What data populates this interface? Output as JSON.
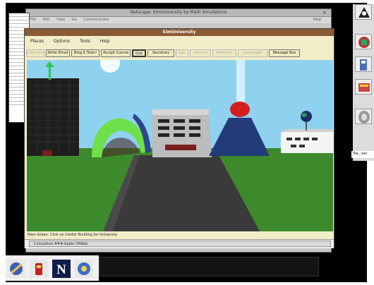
{
  "background_window": {
    "title": "Netscape: SimUniversity by Math Simulations",
    "menu": [
      "File",
      "Edit",
      "View",
      "Go",
      "Communicator"
    ],
    "help": "Help",
    "close": "×"
  },
  "main_window": {
    "title": "SimUniversity",
    "menu": [
      "Places",
      "Options",
      "Tools",
      "Help"
    ],
    "toolbar": [
      {
        "label": "Class Enroll",
        "enabled": false
      },
      {
        "label": "Write Email",
        "enabled": true
      },
      {
        "label": "Blog It Town!",
        "enabled": true
      },
      {
        "label": "Accept Course",
        "enabled": true
      },
      {
        "label": "Quit",
        "enabled": true,
        "pressed": true
      },
      {
        "label": "Secretary",
        "enabled": true
      },
      {
        "label": "Lab",
        "enabled": false
      },
      {
        "label": "General",
        "enabled": false
      },
      {
        "label": "Research",
        "enabled": false
      },
      {
        "label": "Languages",
        "enabled": false
      },
      {
        "label": "Message Box",
        "enabled": true
      }
    ],
    "status": "Main Green: Click on Center Building for University",
    "sub_status": "Completed ###.Apple VRWeb"
  },
  "right_caption": "Tra...nel",
  "colors": {
    "sky": "#8fd2f0",
    "grass": "#3d8a2c",
    "road": "#3a3a3a",
    "title_bar": "#8a5a34",
    "window_bg": "#f1edc8"
  },
  "icons": [
    "netscape-icon",
    "trash-icon",
    "netscape-n-icon",
    "quicktime-icon"
  ]
}
